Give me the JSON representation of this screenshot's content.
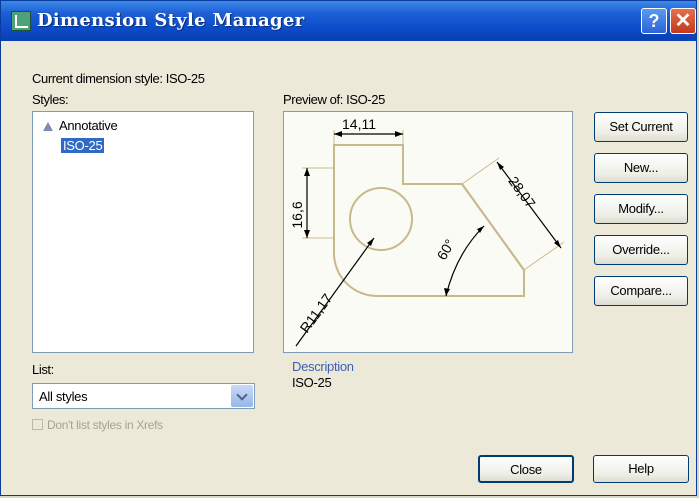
{
  "window": {
    "title": "Dimension Style Manager",
    "help_glyph": "?",
    "close_glyph": "✕"
  },
  "current_style": "Current dimension style: ISO-25",
  "styles": {
    "label": "Styles:",
    "items": [
      {
        "label": "Annotative",
        "icon": "annotative-icon"
      },
      {
        "label": "ISO-25",
        "selected": true
      }
    ]
  },
  "preview": {
    "label": "Preview of: ISO-25",
    "dims": {
      "top": "14,11",
      "left": "16,6",
      "slant": "28,07",
      "angle": "60°",
      "radius": "R11,17"
    }
  },
  "buttons": {
    "set_current": "Set Current",
    "new": "New...",
    "modify": "Modify...",
    "override": "Override...",
    "compare": "Compare...",
    "close": "Close",
    "help": "Help"
  },
  "list": {
    "label": "List:",
    "value": "All styles"
  },
  "checkbox": {
    "label": "Don't list styles in Xrefs"
  },
  "description": {
    "label": "Description",
    "value": "ISO-25"
  },
  "colors": {
    "title_bar": "#0b4bc9",
    "selection": "#316ac5",
    "face": "#ece9d8",
    "drawing_line": "#c8b88c"
  }
}
